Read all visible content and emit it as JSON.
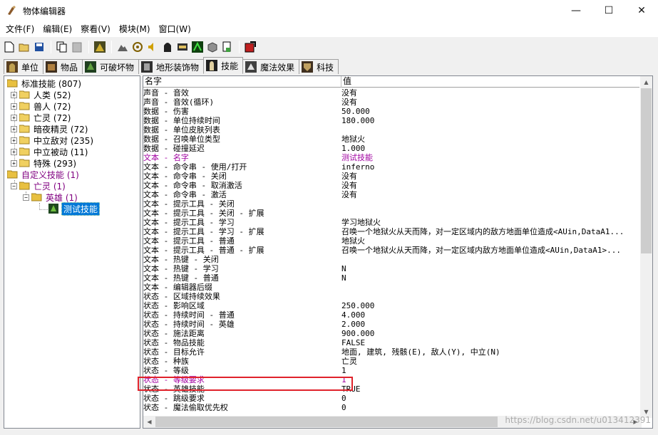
{
  "window": {
    "title": "物体编辑器",
    "minimize": "—",
    "maximize": "☐",
    "close": "✕"
  },
  "menu": [
    "文件(F)",
    "编辑(E)",
    "察看(V)",
    "模块(M)",
    "窗口(W)"
  ],
  "tabs": [
    {
      "label": "单位",
      "active": false
    },
    {
      "label": "物品",
      "active": false
    },
    {
      "label": "可破坏物",
      "active": false
    },
    {
      "label": "地形装饰物",
      "active": false
    },
    {
      "label": "技能",
      "active": true
    },
    {
      "label": "魔法效果",
      "active": false
    },
    {
      "label": "科技",
      "active": false
    }
  ],
  "tree": {
    "root": "标准技能 (807)",
    "standard": [
      "人类 (52)",
      "兽人 (72)",
      "亡灵 (72)",
      "暗夜精灵 (72)",
      "中立敌对 (235)",
      "中立被动 (11)",
      "特殊 (293)"
    ],
    "custom_root": "自定义技能 (1)",
    "custom_undead": "亡灵 (1)",
    "custom_hero": "英雄 (1)",
    "custom_skill": "测试技能"
  },
  "grid": {
    "headers": {
      "name": "名字",
      "value": "值"
    },
    "rows": [
      {
        "name": "声音 - 音效",
        "value": "没有"
      },
      {
        "name": "声音 - 音效(循环)",
        "value": "没有"
      },
      {
        "name": "数据 - 伤害",
        "value": "50.000"
      },
      {
        "name": "数据 - 单位持续时间",
        "value": "180.000"
      },
      {
        "name": "数据 - 单位皮肤列表",
        "value": ""
      },
      {
        "name": "数据 - 召唤单位类型",
        "value": "地狱火"
      },
      {
        "name": "数据 - 碰撞延迟",
        "value": "1.000"
      },
      {
        "name": "文本 - 名字",
        "value": "测试技能",
        "style": "purple"
      },
      {
        "name": "文本 - 命令串 - 使用/打开",
        "value": "inferno"
      },
      {
        "name": "文本 - 命令串 - 关闭",
        "value": "没有"
      },
      {
        "name": "文本 - 命令串 - 取消激活",
        "value": "没有"
      },
      {
        "name": "文本 - 命令串 - 激活",
        "value": "没有"
      },
      {
        "name": "文本 - 提示工具 - 关闭",
        "value": ""
      },
      {
        "name": "文本 - 提示工具 - 关闭 - 扩展",
        "value": ""
      },
      {
        "name": "文本 - 提示工具 - 学习",
        "value": "学习地狱火"
      },
      {
        "name": "文本 - 提示工具 - 学习 - 扩展",
        "value": "召唤一个地狱火从天而降，对一定区域内的敌方地面单位造成<AUin,DataA1..."
      },
      {
        "name": "文本 - 提示工具 - 普通",
        "value": "地狱火"
      },
      {
        "name": "文本 - 提示工具 - 普通 - 扩展",
        "value": "召唤一个地狱火从天而降，对一定区域内敌方地面单位造成<AUin,DataA1>..."
      },
      {
        "name": "文本 - 热键 - 关闭",
        "value": ""
      },
      {
        "name": "文本 - 热键 - 学习",
        "value": "N"
      },
      {
        "name": "文本 - 热键 - 普通",
        "value": "N"
      },
      {
        "name": "文本 - 编辑器后缀",
        "value": ""
      },
      {
        "name": "状态 - 区域持续效果",
        "value": ""
      },
      {
        "name": "状态 - 影响区域",
        "value": "250.000"
      },
      {
        "name": "状态 - 持续时间 - 普通",
        "value": "4.000"
      },
      {
        "name": "状态 - 持续时间 - 英雄",
        "value": "2.000"
      },
      {
        "name": "状态 - 施法距离",
        "value": "900.000"
      },
      {
        "name": "状态 - 物品技能",
        "value": "FALSE"
      },
      {
        "name": "状态 - 目标允许",
        "value": "地面, 建筑, 残骸(E), 敌人(Y), 中立(N)"
      },
      {
        "name": "状态 - 种族",
        "value": "亡灵"
      },
      {
        "name": "状态 - 等级",
        "value": "1"
      },
      {
        "name": "状态 - 等级要求",
        "value": "1",
        "style": "purple"
      },
      {
        "name": "状态 - 英雄技能",
        "value": "TRUE"
      },
      {
        "name": "状态 - 跳级要求",
        "value": "0"
      },
      {
        "name": "状态 - 魔法偷取优先权",
        "value": "0"
      }
    ]
  },
  "watermark": "https://blog.csdn.net/u013412391",
  "colors": {
    "highlight_box": "#e0222b",
    "modified_text": "#a000a0",
    "selection": "#0078d7"
  }
}
